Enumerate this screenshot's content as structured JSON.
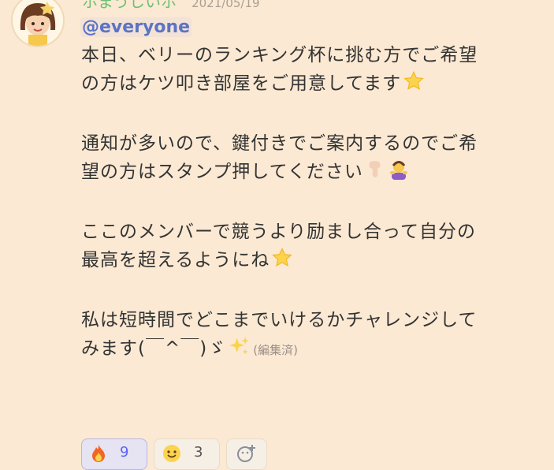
{
  "message": {
    "author": "ホまうしいホ",
    "timestamp": "2021/05/19",
    "mention": "@everyone",
    "lines": [
      "本日、ベリーのランキング杯に挑む方でご希望",
      "の方はケツ叩き部屋をご用意してます",
      "通知が多いので、鍵付きでご案内するのでご希",
      "望の方はスタンプ押してください",
      "ここのメンバーで競うより励まし合って自分の",
      "最高を超えるようにね",
      "私は短時間でどこまでいけるかチャレンジして",
      "みます(￣^￣)ゞ"
    ],
    "edited_label": "(編集済)"
  },
  "reactions": [
    {
      "icon": "fire-icon",
      "count": "9",
      "active": true
    },
    {
      "icon": "grinning-face-icon",
      "count": "3",
      "active": false
    },
    {
      "icon": "add-reaction-icon",
      "count": "",
      "active": false
    }
  ],
  "colors": {
    "background": "#fbe9d3",
    "author": "#6fbf73",
    "mention": "#5b74c4",
    "text": "#333333"
  }
}
